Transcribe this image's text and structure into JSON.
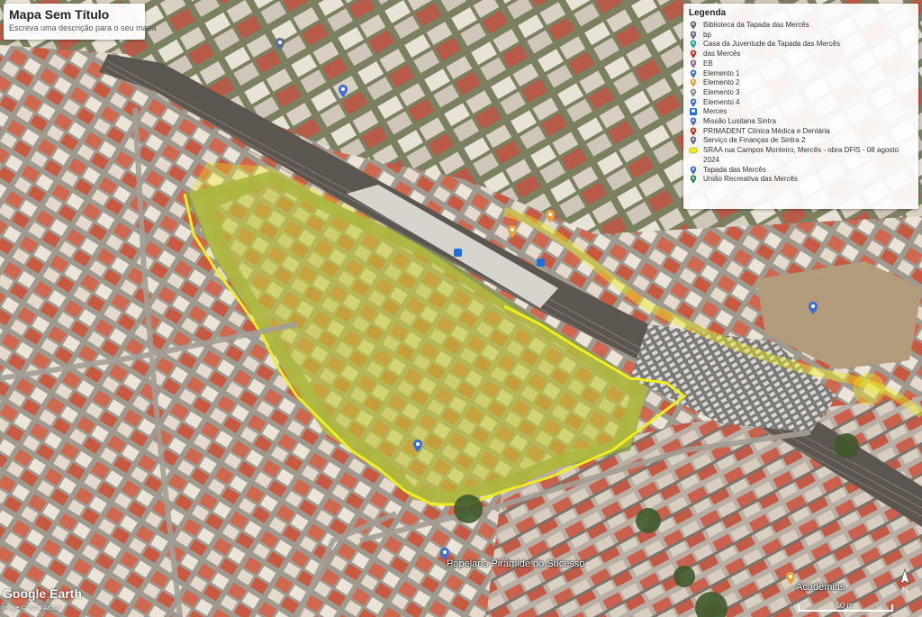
{
  "map": {
    "title": "Mapa Sem Título",
    "description": "Escreva uma descrição para o seu mapa",
    "attribution_logo": "Google Earth",
    "attribution_credit": "Image © 2024 Airbus",
    "scale_label": "60 m",
    "compass": "N"
  },
  "legend": {
    "title": "Legenda",
    "items": [
      {
        "label": "Biblioteca da Tapada das Mercês",
        "icon": "pin-icon",
        "color": "#5c6f8f"
      },
      {
        "label": "bp",
        "icon": "pin-icon",
        "color": "#5c6f8f"
      },
      {
        "label": "Casa da Juventude da Tapada das Mercês",
        "icon": "pin-icon",
        "color": "#26a69a"
      },
      {
        "label": "das Mercês",
        "icon": "pin-icon",
        "color": "#c0392b"
      },
      {
        "label": "EB",
        "icon": "pin-icon",
        "color": "#8e6fa0"
      },
      {
        "label": "Elemento 1",
        "icon": "pin-icon",
        "color": "#3f6fd0"
      },
      {
        "label": "Elemento 2",
        "icon": "pin-icon",
        "color": "#e6a23c"
      },
      {
        "label": "Elemento 3",
        "icon": "pin-icon",
        "color": "#8a8f9a"
      },
      {
        "label": "Elemento 4",
        "icon": "pin-icon",
        "color": "#3f6fd0"
      },
      {
        "label": "Merces",
        "icon": "train-icon",
        "color": "#1e6fd9"
      },
      {
        "label": "Missão Lusitana Sintra",
        "icon": "pin-icon",
        "color": "#3f6fd0"
      },
      {
        "label": "PRIMADENT Clínica Médica e Dentária",
        "icon": "pin-icon",
        "color": "#c0392b"
      },
      {
        "label": "Serviço de Finanças de Sintra 2",
        "icon": "pin-icon",
        "color": "#5c6f8f"
      },
      {
        "label": "SRAA rua Campos Monteiro, Mercês - obra DFIS - 08 agosto 2024",
        "icon": "polygon-icon",
        "color": "#f2ee1e"
      },
      {
        "label": "Tapada das Mercês",
        "icon": "pin-icon",
        "color": "#3f6fd0"
      },
      {
        "label": "União Recreativa das Mercês",
        "icon": "pin-icon",
        "color": "#2e8b57"
      }
    ]
  },
  "map_labels": [
    {
      "text": "Papelaria Pirâmide do Sucesso",
      "kind": "big"
    },
    {
      "text": "Acadêmias",
      "kind": "big"
    }
  ],
  "colors": {
    "highlight": "#f2ee1e",
    "roof": "#c9614e",
    "facade": "#e8ddd0",
    "grass": "#7d8b4a",
    "rail": "#5b5650"
  }
}
